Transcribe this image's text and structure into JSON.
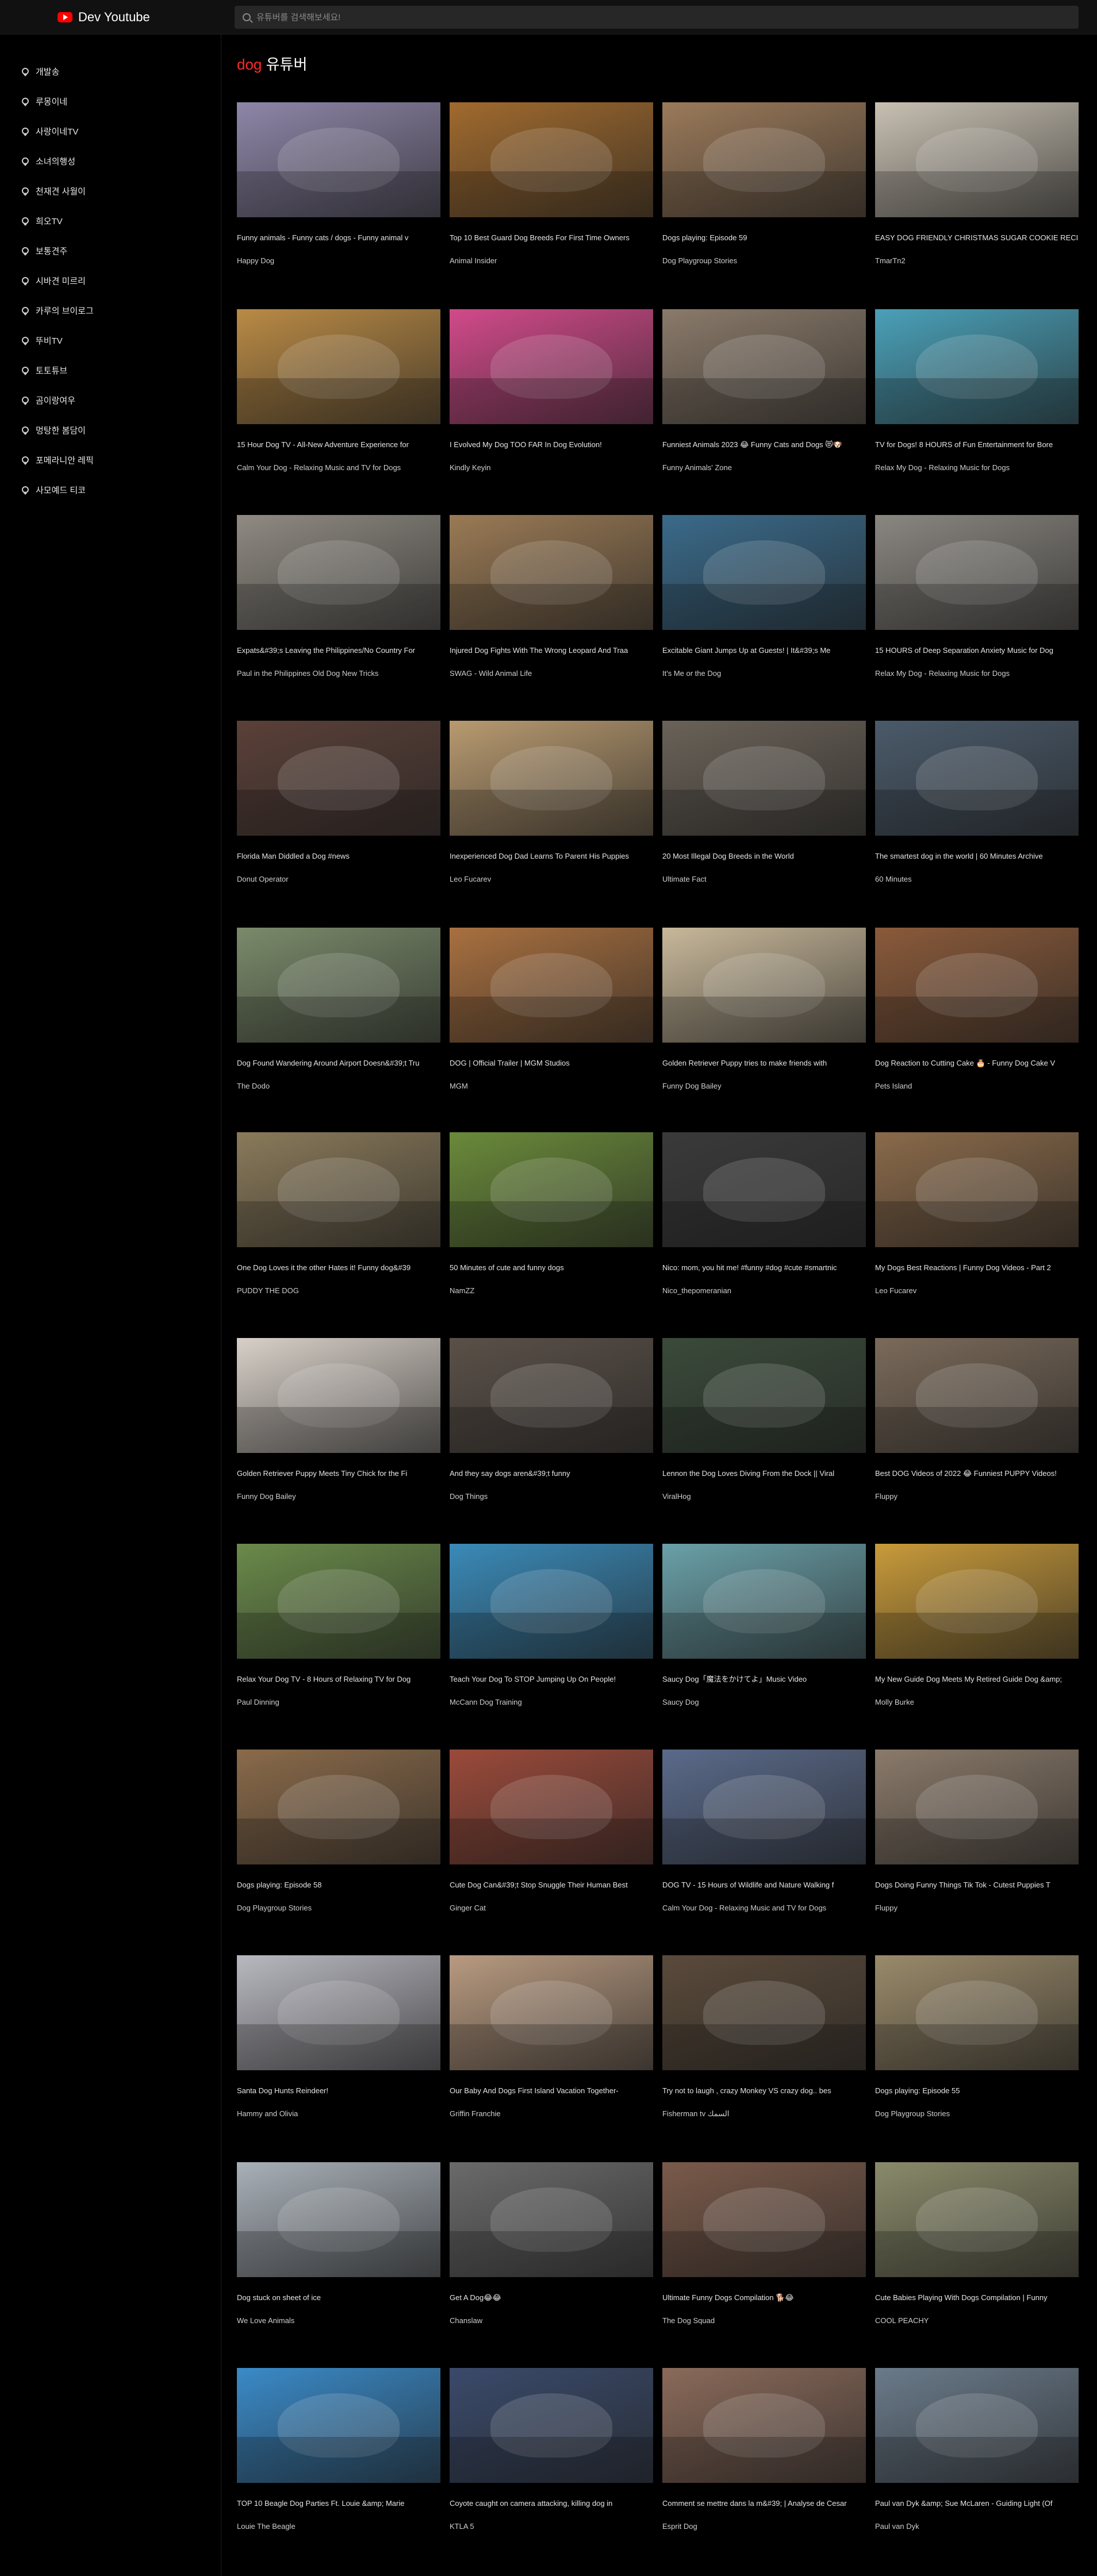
{
  "header": {
    "logo_text": "Dev Youtube",
    "search_placeholder": "유튜버를 검색해보세요!"
  },
  "sidebar": {
    "items": [
      {
        "label": "개발송"
      },
      {
        "label": "루몽이네"
      },
      {
        "label": "사랑이네TV"
      },
      {
        "label": "소녀의행성"
      },
      {
        "label": "천재견 사월이"
      },
      {
        "label": "희오TV"
      },
      {
        "label": "보통견주"
      },
      {
        "label": "시바견 미르리"
      },
      {
        "label": "카루의 브이로그"
      },
      {
        "label": "뚜비TV"
      },
      {
        "label": "토토튜브"
      },
      {
        "label": "곰이랑여우"
      },
      {
        "label": "멍탕한 봄담이"
      },
      {
        "label": "포메라니안 레픽"
      },
      {
        "label": "사모예드 티코"
      }
    ]
  },
  "main": {
    "title_keyword": "dog",
    "title_rest": " 유튜버"
  },
  "videos": [
    {
      "title": "Funny animals - Funny cats / dogs - Funny animal v",
      "channel": "Happy Dog",
      "color": "#8e86a8"
    },
    {
      "title": "Top 10 Best Guard Dog Breeds For First Time Owners",
      "channel": "Animal Insider",
      "color": "#a06a2e"
    },
    {
      "title": "Dogs playing: Episode 59",
      "channel": "Dog Playgroup Stories",
      "color": "#9b7a5a"
    },
    {
      "title": "EASY DOG FRIENDLY CHRISTMAS SUGAR COOKIE RECIPE",
      "channel": "TmarTn2",
      "color": "#c8c0b2"
    },
    {
      "title": "15 Hour Dog TV - All-New Adventure Experience for",
      "channel": "Calm Your Dog - Relaxing Music and TV for Dogs",
      "color": "#b98a45"
    },
    {
      "title": "I Evolved My Dog TOO FAR In Dog Evolution!",
      "channel": "Kindly Keyin",
      "color": "#d14a8a"
    },
    {
      "title": "Funniest Animals 2023 😂 Funny Cats and Dogs 😻🐶",
      "channel": "Funny Animals' Zone",
      "color": "#8a7a6a"
    },
    {
      "title": "TV for Dogs! 8 HOURS of Fun Entertainment for Bore",
      "channel": "Relax My Dog - Relaxing Music for Dogs",
      "color": "#4aa0b8"
    },
    {
      "title": "Expats&#39;s Leaving the Philippines/No Country For",
      "channel": "Paul in the Philippines Old Dog New Tricks",
      "color": "#8f8a82"
    },
    {
      "title": "Injured Dog Fights With The Wrong Leopard And Traa",
      "channel": "SWAG - Wild Animal Life",
      "color": "#9a7a55"
    },
    {
      "title": "Excitable Giant Jumps Up at Guests! | It&#39;s Me",
      "channel": "It's Me or the Dog",
      "color": "#3a6a8a"
    },
    {
      "title": "15 HOURS of Deep Separation Anxiety Music for Dog",
      "channel": "Relax My Dog - Relaxing Music for Dogs",
      "color": "#8a8680"
    },
    {
      "title": "Florida Man Diddled a Dog #news",
      "channel": "Donut Operator",
      "color": "#5a4038"
    },
    {
      "title": "Inexperienced Dog Dad Learns To Parent His Puppies",
      "channel": "Leo Fucarev",
      "color": "#b89a70"
    },
    {
      "title": "20 Most Illegal Dog Breeds in the World",
      "channel": "Ultimate Fact",
      "color": "#6a6258"
    },
    {
      "title": "The smartest dog in the world | 60 Minutes Archive",
      "channel": "60 Minutes",
      "color": "#4a5a6a"
    },
    {
      "title": "Dog Found Wandering Around Airport Doesn&#39;t Tru",
      "channel": "The Dodo",
      "color": "#7a8a6a"
    },
    {
      "title": "DOG | Official Trailer | MGM Studios",
      "channel": "MGM",
      "color": "#a87040"
    },
    {
      "title": "Golden Retriever Puppy tries to make friends with",
      "channel": "Funny Dog Bailey",
      "color": "#c8b89a"
    },
    {
      "title": "Dog Reaction to Cutting Cake 🎂 - Funny Dog Cake V",
      "channel": "Pets Island",
      "color": "#8a5a3a"
    },
    {
      "title": "One Dog Loves it the other Hates it! Funny dog&#39",
      "channel": "PUDDY THE DOG",
      "color": "#8a7a5a"
    },
    {
      "title": "50 Minutes of cute and funny dogs",
      "channel": "NamZZ",
      "color": "#6a8a3a"
    },
    {
      "title": "Nico: mom, you hit me! #funny #dog #cute #smartnic",
      "channel": "Nico_thepomeranian",
      "color": "#3a3a3a"
    },
    {
      "title": "My Dogs Best Reactions | Funny Dog Videos - Part 2",
      "channel": "Leo Fucarev",
      "color": "#8a6a4a"
    },
    {
      "title": "Golden Retriever Puppy Meets Tiny Chick for the Fi",
      "channel": "Funny Dog Bailey",
      "color": "#d8d0c8"
    },
    {
      "title": "And they say dogs aren&#39;t funny",
      "channel": "Dog Things",
      "color": "#5a5048"
    },
    {
      "title": "Lennon the Dog Loves Diving From the Dock || Viral",
      "channel": "ViralHog",
      "color": "#3a4a3a"
    },
    {
      "title": "Best DOG Videos of 2022 😂 Funniest PUPPY Videos!",
      "channel": "Fluppy",
      "color": "#7a6a5a"
    },
    {
      "title": "Relax Your Dog TV - 8 Hours of Relaxing TV for Dog",
      "channel": "Paul Dinning",
      "color": "#6a8a4a"
    },
    {
      "title": "Teach Your Dog To STOP Jumping Up On People!",
      "channel": "McCann Dog Training",
      "color": "#3a8ab8"
    },
    {
      "title": "Saucy Dog「魔法をかけてよ」Music Video",
      "channel": "Saucy Dog",
      "color": "#6aa0a8"
    },
    {
      "title": "My New Guide Dog Meets My Retired Guide Dog &amp;",
      "channel": "Molly Burke",
      "color": "#c89a3a"
    },
    {
      "title": "Dogs playing: Episode 58",
      "channel": "Dog Playgroup Stories",
      "color": "#8a6a4a"
    },
    {
      "title": "Cute Dog Can&#39;t Stop Snuggle Their Human Best",
      "channel": "Ginger Cat",
      "color": "#9a4a3a"
    },
    {
      "title": "DOG TV - 15 Hours of Wildlife and Nature Walking f",
      "channel": "Calm Your Dog - Relaxing Music and TV for Dogs",
      "color": "#5a6a8a"
    },
    {
      "title": "Dogs Doing Funny Things Tik Tok - Cutest Puppies T",
      "channel": "Fluppy",
      "color": "#8a7a6a"
    },
    {
      "title": "Santa Dog Hunts Reindeer!",
      "channel": "Hammy and Olivia",
      "color": "#b8b8c0"
    },
    {
      "title": "Our Baby And Dogs First Island Vacation Together-",
      "channel": "Griffin Franchie",
      "color": "#b89a80"
    },
    {
      "title": "Try not to laugh , crazy Monkey VS crazy dog.. bes",
      "channel": "Fisherman tv السمك",
      "color": "#5a4a3a"
    },
    {
      "title": "Dogs playing: Episode 55",
      "channel": "Dog Playgroup Stories",
      "color": "#9a8a6a"
    },
    {
      "title": "Dog stuck on sheet of ice",
      "channel": "We Love Animals",
      "color": "#a8b0b8"
    },
    {
      "title": "Get A Dog😂😂",
      "channel": "Chanslaw",
      "color": "#6a6a6a"
    },
    {
      "title": "Ultimate Funny Dogs Compilation 🐕😂",
      "channel": "The Dog Squad",
      "color": "#7a5a4a"
    },
    {
      "title": "Cute Babies Playing With Dogs Compilation | Funny",
      "channel": "COOL PEACHY",
      "color": "#8a8a6a"
    },
    {
      "title": "TOP 10 Beagle Dog Parties Ft. Louie &amp; Marie",
      "channel": "Louie The Beagle",
      "color": "#3a8ac8"
    },
    {
      "title": "Coyote caught on camera attacking, killing dog in",
      "channel": "KTLA 5",
      "color": "#3a4a6a"
    },
    {
      "title": "Comment se mettre dans la m&#39; | Analyse de Cesar",
      "channel": "Esprit Dog",
      "color": "#8a6a5a"
    },
    {
      "title": "Paul van Dyk &amp; Sue McLaren - Guiding Light (Of",
      "channel": "Paul van Dyk",
      "color": "#6a7a8a"
    }
  ]
}
